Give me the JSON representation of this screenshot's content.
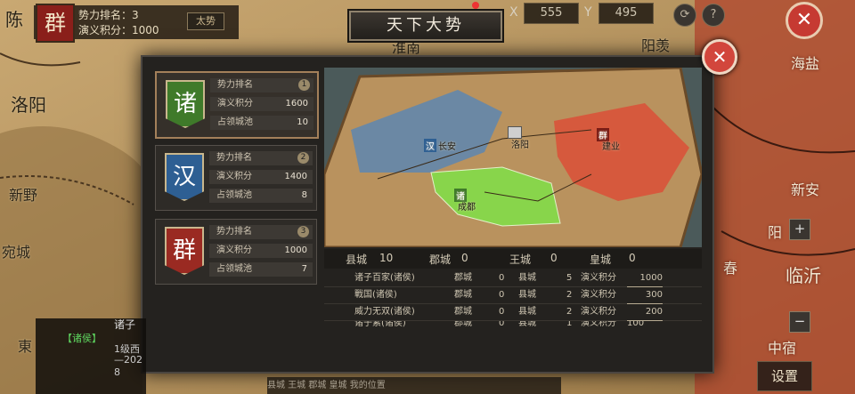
{
  "header": {
    "faction_flag": "群",
    "rank_label": "势力排名：3",
    "score_label": "演义积分：1000",
    "mini_button": "太势",
    "x_label": "X",
    "x_value": "555",
    "y_label": "Y",
    "y_value": "495",
    "close": "✕"
  },
  "title": "天下大势",
  "dialog_close": "✕",
  "factions": [
    {
      "flag": "诸",
      "color": "#3f7a2a",
      "rows": [
        {
          "k": "势力排名",
          "v": ""
        },
        {
          "k": "演义积分",
          "v": "1600"
        },
        {
          "k": "占领城池",
          "v": "10"
        }
      ],
      "badge": "1"
    },
    {
      "flag": "汉",
      "color": "#2e5f93",
      "rows": [
        {
          "k": "势力排名",
          "v": ""
        },
        {
          "k": "演义积分",
          "v": "1400"
        },
        {
          "k": "占领城池",
          "v": "8"
        }
      ],
      "badge": "2"
    },
    {
      "flag": "群",
      "color": "#9a2a22",
      "rows": [
        {
          "k": "势力排名",
          "v": ""
        },
        {
          "k": "演义积分",
          "v": "1000"
        },
        {
          "k": "占领城池",
          "v": "7"
        }
      ],
      "badge": "3"
    }
  ],
  "map_panel": {
    "cities": [
      "长安",
      "洛阳",
      "建业",
      "成都"
    ],
    "flags": [
      "汉",
      "群",
      "诸"
    ],
    "colors": {
      "han": "#5d86b0",
      "qun": "#d9533a",
      "zhu": "#86d94a",
      "land": "#b9925e"
    }
  },
  "stats": {
    "county_label": "县城",
    "county_value": "10",
    "prefecture_label": "郡城",
    "prefecture_value": "0",
    "king_label": "王城",
    "king_value": "0",
    "imperial_label": "皇城",
    "imperial_value": "0"
  },
  "table_rows": [
    {
      "name": "诸子百家(诸侯)",
      "jun": "郡城",
      "jv": "0",
      "xian": "县城",
      "xv": "5",
      "score_label": "演义积分",
      "score": "1000"
    },
    {
      "name": "戰国(诸侯)",
      "jun": "郡城",
      "jv": "0",
      "xian": "县城",
      "xv": "2",
      "score_label": "演义积分",
      "score": "300"
    },
    {
      "name": "威力无双(诸侯)",
      "jun": "郡城",
      "jv": "0",
      "xian": "县城",
      "xv": "2",
      "score_label": "演义积分",
      "score": "200"
    },
    {
      "name": "诸子素(诸侯)",
      "jun": "郡城",
      "jv": "0",
      "xian": "县城",
      "xv": "1",
      "score_label": "演义积分",
      "score": "100"
    }
  ],
  "map_labels": {
    "left_city_1": "陈",
    "luoyang": "洛阳",
    "xinye": "新野",
    "wancheng": "宛城",
    "huainan": "淮南",
    "yangxi": "阳羡",
    "haiyan": "海盐",
    "xinan": "新安",
    "yang": "阳",
    "chun": "春",
    "linyi": "临沂",
    "zhongsu": "中宿",
    "dong": "東"
  },
  "event": {
    "tag": "【诸侯】",
    "line1": "诸子",
    "line2": "1级西",
    "line3": "—202",
    "line4": "8"
  },
  "bottom_bar": "县城  王城  郡城  皇城  我的位置",
  "settings": "设置",
  "zoom_in": "+",
  "zoom_out": "−"
}
